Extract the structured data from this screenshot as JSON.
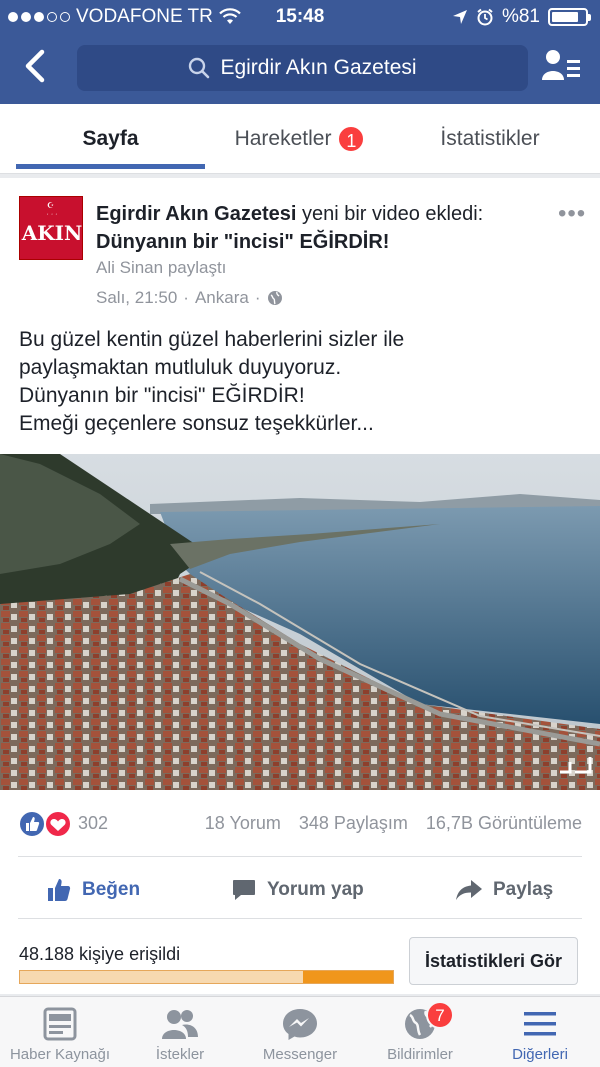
{
  "status_bar": {
    "carrier": "VODAFONE TR",
    "time": "15:48",
    "battery": "%81",
    "battery_level": 0.81,
    "signal_bars_filled": 3,
    "signal_bars_total": 5
  },
  "header": {
    "search_text": "Egirdir Akın Gazetesi",
    "back_icon": "chevron-left-icon",
    "profile_icon": "profile-list-icon",
    "color": "#3b5998"
  },
  "tabs": [
    {
      "label": "Sayfa",
      "active": true
    },
    {
      "label": "Hareketler",
      "badge": "1"
    },
    {
      "label": "İstatistikler"
    }
  ],
  "post": {
    "page_name": "Egirdir Akın Gazetesi",
    "action_text": " yeni bir video ekledi: ",
    "video_title": "Dünyanın bir \"incisi\" EĞİRDİR!",
    "shared_by": "Ali Sinan paylaştı",
    "time": "Salı, 21:50",
    "separator": "·",
    "location": "Ankara",
    "logo_text": "AKIN",
    "text_lines": [
      "Bu güzel kentin güzel haberlerini sizler ile",
      "paylaşmaktan mutluluk duyuyoruz.",
      "Dünyanın bir \"incisi\" EĞİRDİR!",
      "Emeği geçenlere sonsuz teşekkürler..."
    ]
  },
  "engagement": {
    "reactions_count": "302",
    "comments": "18 Yorum",
    "shares": "348 Paylaşım",
    "views": "16,7B Görüntüleme"
  },
  "actions": {
    "like": "Beğen",
    "comment": "Yorum yap",
    "share": "Paylaş"
  },
  "reach": {
    "text": "48.188 kişiye erişildi",
    "paid_fraction": 0.24,
    "button": "İstatistikleri Gör"
  },
  "bottom_nav": [
    {
      "label": "Haber Kaynağı",
      "icon": "news-feed-icon"
    },
    {
      "label": "İstekler",
      "icon": "friend-requests-icon"
    },
    {
      "label": "Messenger",
      "icon": "messenger-icon"
    },
    {
      "label": "Bildirimler",
      "icon": "globe-icon",
      "badge": "7"
    },
    {
      "label": "Diğerleri",
      "icon": "menu-icon",
      "active": true
    }
  ],
  "colors": {
    "brand": "#3b5998",
    "accent": "#4267b2",
    "badge": "#fa3e3e",
    "reach_bar": "#f0961c"
  }
}
